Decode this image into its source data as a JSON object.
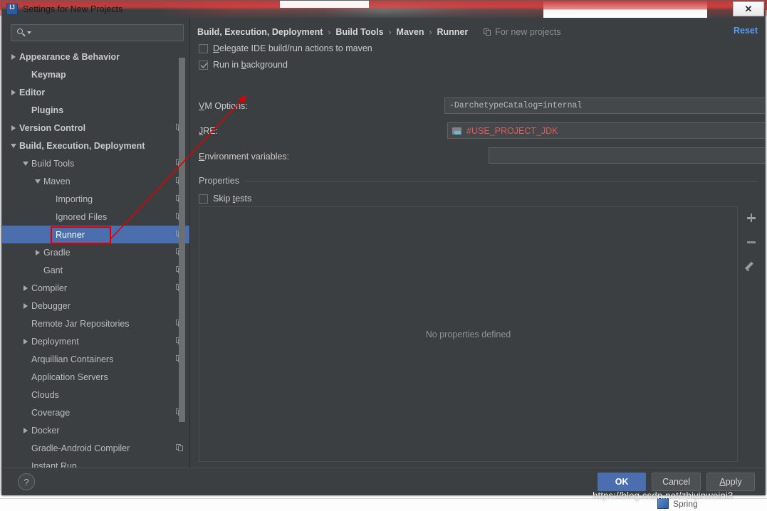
{
  "window": {
    "title": "Settings for New Projects",
    "app_icon": "intellij-idea-icon",
    "close_label": "✕"
  },
  "sidebar": {
    "search": {
      "value": "",
      "placeholder": ""
    },
    "items": [
      {
        "label": "Appearance & Behavior",
        "indent": 0,
        "twisty": "right",
        "bold": true,
        "copy": false,
        "selected": false
      },
      {
        "label": "Keymap",
        "indent": 1,
        "twisty": "none",
        "bold": true,
        "copy": false,
        "selected": false
      },
      {
        "label": "Editor",
        "indent": 0,
        "twisty": "right",
        "bold": true,
        "copy": false,
        "selected": false
      },
      {
        "label": "Plugins",
        "indent": 1,
        "twisty": "none",
        "bold": true,
        "copy": false,
        "selected": false
      },
      {
        "label": "Version Control",
        "indent": 0,
        "twisty": "right",
        "bold": true,
        "copy": true,
        "selected": false
      },
      {
        "label": "Build, Execution, Deployment",
        "indent": 0,
        "twisty": "down",
        "bold": true,
        "copy": false,
        "selected": false
      },
      {
        "label": "Build Tools",
        "indent": 1,
        "twisty": "down",
        "bold": false,
        "copy": true,
        "selected": false
      },
      {
        "label": "Maven",
        "indent": 2,
        "twisty": "down",
        "bold": false,
        "copy": true,
        "selected": false
      },
      {
        "label": "Importing",
        "indent": 3,
        "twisty": "none",
        "bold": false,
        "copy": true,
        "selected": false
      },
      {
        "label": "Ignored Files",
        "indent": 3,
        "twisty": "none",
        "bold": false,
        "copy": true,
        "selected": false
      },
      {
        "label": "Runner",
        "indent": 3,
        "twisty": "none",
        "bold": false,
        "copy": true,
        "selected": true
      },
      {
        "label": "Gradle",
        "indent": 2,
        "twisty": "right",
        "bold": false,
        "copy": true,
        "selected": false
      },
      {
        "label": "Gant",
        "indent": 2,
        "twisty": "none",
        "bold": false,
        "copy": true,
        "selected": false
      },
      {
        "label": "Compiler",
        "indent": 1,
        "twisty": "right",
        "bold": false,
        "copy": true,
        "selected": false
      },
      {
        "label": "Debugger",
        "indent": 1,
        "twisty": "right",
        "bold": false,
        "copy": false,
        "selected": false
      },
      {
        "label": "Remote Jar Repositories",
        "indent": 1,
        "twisty": "none",
        "bold": false,
        "copy": true,
        "selected": false
      },
      {
        "label": "Deployment",
        "indent": 1,
        "twisty": "right",
        "bold": false,
        "copy": true,
        "selected": false
      },
      {
        "label": "Arquillian Containers",
        "indent": 1,
        "twisty": "none",
        "bold": false,
        "copy": true,
        "selected": false
      },
      {
        "label": "Application Servers",
        "indent": 1,
        "twisty": "none",
        "bold": false,
        "copy": false,
        "selected": false
      },
      {
        "label": "Clouds",
        "indent": 1,
        "twisty": "none",
        "bold": false,
        "copy": false,
        "selected": false
      },
      {
        "label": "Coverage",
        "indent": 1,
        "twisty": "none",
        "bold": false,
        "copy": true,
        "selected": false
      },
      {
        "label": "Docker",
        "indent": 1,
        "twisty": "right",
        "bold": false,
        "copy": false,
        "selected": false
      },
      {
        "label": "Gradle-Android Compiler",
        "indent": 1,
        "twisty": "none",
        "bold": false,
        "copy": true,
        "selected": false
      },
      {
        "label": "Instant Run",
        "indent": 1,
        "twisty": "none",
        "bold": false,
        "copy": false,
        "selected": false
      }
    ]
  },
  "main": {
    "breadcrumb": [
      "Build, Execution, Deployment",
      "Build Tools",
      "Maven",
      "Runner"
    ],
    "breadcrumb_separator": "›",
    "scope_label": "For new projects",
    "scope_icon": "copy-icon",
    "reset_label": "Reset",
    "delegate_checkbox": {
      "label": "Delegate IDE build/run actions to maven",
      "checked": false
    },
    "background_checkbox": {
      "label": "Run in background",
      "checked": true
    },
    "vm_options": {
      "label": "VM Options:",
      "value": "-DarchetypeCatalog=internal",
      "expand_icon": "expand-icon"
    },
    "jre": {
      "label": "JRE:",
      "value": "#USE_PROJECT_JDK",
      "icon": "folder-icon",
      "caret_icon": "chevron-down-icon"
    },
    "env_vars": {
      "label": "Environment variables:",
      "value": "",
      "browse_icon": "folder-browse-icon"
    },
    "properties_group_label": "Properties",
    "skip_tests_checkbox": {
      "label": "Skip tests",
      "checked": false
    },
    "properties_empty_text": "No properties defined",
    "properties_toolbar": [
      {
        "name": "add-property-button",
        "icon": "plus-icon"
      },
      {
        "name": "remove-property-button",
        "icon": "minus-icon"
      },
      {
        "name": "edit-property-button",
        "icon": "pencil-icon"
      }
    ]
  },
  "footer": {
    "help_label": "?",
    "ok_label": "OK",
    "cancel_label": "Cancel",
    "apply_label": "Apply"
  },
  "annotations": {
    "watermark": "https://blog.csdn.net/zhiyinweini3",
    "highlight_color": "#e00000",
    "arrow": {
      "from": "sidebar-item-runner",
      "to": "vm-options-input"
    }
  },
  "background": {
    "tab_label": "Spring"
  },
  "colors": {
    "panel": "#3c3f41",
    "selection": "#4b6eaf",
    "link": "#589df6",
    "value_red": "#e05c5c",
    "annotation_red": "#e00000"
  }
}
